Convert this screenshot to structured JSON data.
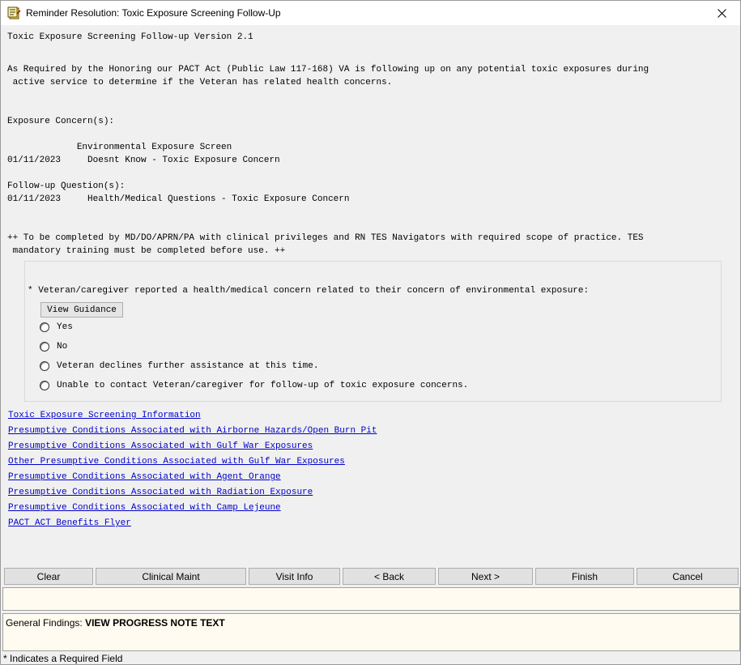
{
  "window": {
    "title": "Reminder Resolution: Toxic Exposure Screening Follow-Up",
    "close_glyph": "✕"
  },
  "body_lines": [
    "Toxic Exposure Screening Follow-up Version 2.1",
    "As Required by the Honoring our PACT Act (Public Law 117-168) VA is following up on any potential toxic exposures during",
    " active service to determine if the Veteran has related health concerns.",
    "Exposure Concern(s):",
    "             Environmental Exposure Screen",
    "01/11/2023     Doesnt Know - Toxic Exposure Concern",
    "Follow-up Question(s):",
    "01/11/2023     Health/Medical Questions - Toxic Exposure Concern",
    "++ To be completed by MD/DO/APRN/PA with clinical privileges and RN TES Navigators with required scope of practice. TES",
    " mandatory training must be completed before use. ++"
  ],
  "question": {
    "prompt": "* Veteran/caregiver reported a health/medical concern related to their concern of environmental exposure:",
    "guidance_button": "View Guidance",
    "options": [
      "Yes",
      "No",
      "Veteran declines further assistance at this time.",
      "Unable to contact Veteran/caregiver for follow-up of toxic exposure concerns."
    ]
  },
  "links": [
    "Toxic Exposure Screening Information",
    "Presumptive Conditions Associated with Airborne Hazards/Open Burn Pit",
    "Presumptive Conditions Associated with Gulf War Exposures",
    "Other Presumptive Conditions Associated with Gulf War Exposures",
    "Presumptive Conditions Associated with Agent Orange",
    "Presumptive Conditions Associated with Radiation Exposure",
    "Presumptive Conditions Associated with Camp Lejeune",
    "PACT ACT Benefits Flyer"
  ],
  "buttons": {
    "clear": "Clear",
    "clinical_maint": "Clinical Maint",
    "visit_info": "Visit Info",
    "back": "< Back",
    "next": "Next >",
    "finish": "Finish",
    "cancel": "Cancel"
  },
  "findings": {
    "label": "General Findings:",
    "value": "VIEW PROGRESS NOTE TEXT"
  },
  "status": "* Indicates a Required Field",
  "colors": {
    "link": "#0000cc",
    "note_background": "#fffbf0",
    "window_background": "#f0f0f0"
  },
  "icons": {
    "app": "reminder-dialog-icon",
    "close": "close-icon",
    "radio": "radio-button-icon"
  }
}
